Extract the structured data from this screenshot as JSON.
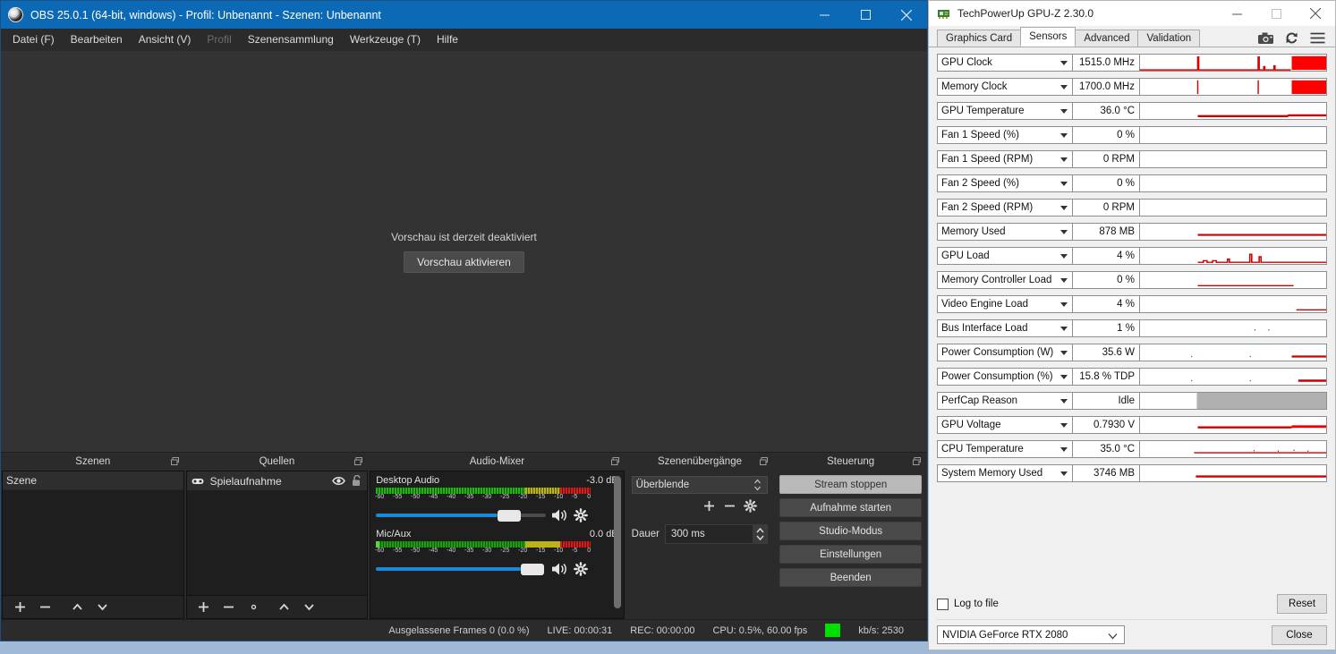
{
  "obs": {
    "title": "OBS 25.0.1 (64-bit, windows) - Profil: Unbenannt - Szenen: Unbenannt",
    "logo_icon": "obs-logo-icon",
    "window_buttons": [
      {
        "name": "minimize-button",
        "label": "—"
      },
      {
        "name": "maximize-button",
        "label": "☐"
      },
      {
        "name": "close-button",
        "label": "✕"
      }
    ],
    "menu": [
      {
        "label": "Datei (F)",
        "disabled": false
      },
      {
        "label": "Bearbeiten",
        "disabled": false
      },
      {
        "label": "Ansicht (V)",
        "disabled": false
      },
      {
        "label": "Profil",
        "disabled": true
      },
      {
        "label": "Szenensammlung",
        "disabled": false
      },
      {
        "label": "Werkzeuge (T)",
        "disabled": false
      },
      {
        "label": "Hilfe",
        "disabled": false
      }
    ],
    "preview": {
      "message": "Vorschau ist derzeit deaktiviert",
      "button": "Vorschau aktivieren"
    },
    "scenes": {
      "title": "Szenen",
      "items": [
        "Szene"
      ],
      "toolbar": [
        "add-icon",
        "remove-icon",
        "move-up-icon",
        "move-down-icon"
      ]
    },
    "sources": {
      "title": "Quellen",
      "items": [
        {
          "label": "Spielaufnahme",
          "type_icon": "game-capture-icon",
          "visible_icon": "eye-icon",
          "lock_icon": "unlocked-icon"
        }
      ],
      "toolbar": [
        "add-icon",
        "remove-icon",
        "properties-gear-icon",
        "move-up-icon",
        "move-down-icon"
      ]
    },
    "mixer": {
      "title": "Audio-Mixer",
      "tracks": [
        {
          "name": "Desktop Audio",
          "level": "-3.0 dB",
          "slider_pct": 71
        },
        {
          "name": "Mic/Aux",
          "level": "0.0 dB",
          "slider_pct": 94
        }
      ],
      "scale_ticks": [
        "-60",
        "-55",
        "-50",
        "-45",
        "-40",
        "-35",
        "-30",
        "-25",
        "-20",
        "-15",
        "-10",
        "-5",
        "0"
      ]
    },
    "transitions": {
      "title": "Szenenübergänge",
      "selected": "Überblende",
      "duration_label": "Dauer",
      "duration_value": "300 ms",
      "buttons": [
        "add-icon",
        "remove-icon",
        "properties-gear-icon"
      ]
    },
    "controls": {
      "title": "Steuerung",
      "buttons": [
        {
          "label": "Stream stoppen",
          "primary": true
        },
        {
          "label": "Aufnahme starten",
          "primary": false
        },
        {
          "label": "Studio-Modus",
          "primary": false
        },
        {
          "label": "Einstellungen",
          "primary": false
        },
        {
          "label": "Beenden",
          "primary": false
        }
      ]
    },
    "status": {
      "dropped_frames": "Ausgelassene Frames 0 (0.0 %)",
      "live": "LIVE: 00:00:31",
      "rec": "REC: 00:00:00",
      "cpu": "CPU: 0.5%, 60.00 fps",
      "live_color": "#00e000",
      "bitrate": "kb/s: 2530"
    }
  },
  "gpuz": {
    "title": "TechPowerUp GPU-Z 2.30.0",
    "icon": "gpu-card-icon",
    "window_buttons": [
      {
        "name": "minimize-button",
        "label": "—"
      },
      {
        "name": "maximize-button",
        "label": "☐"
      },
      {
        "name": "close-button",
        "label": "✕"
      }
    ],
    "tabs": [
      {
        "label": "Graphics Card",
        "active": false
      },
      {
        "label": "Sensors",
        "active": true
      },
      {
        "label": "Advanced",
        "active": false
      },
      {
        "label": "Validation",
        "active": false
      }
    ],
    "tab_icons": [
      "camera-icon",
      "refresh-icon",
      "hamburger-menu-icon"
    ],
    "sensors": [
      {
        "name": "GPU Clock",
        "value": "1515.0 MHz"
      },
      {
        "name": "Memory Clock",
        "value": "1700.0 MHz"
      },
      {
        "name": "GPU Temperature",
        "value": "36.0 °C"
      },
      {
        "name": "Fan 1 Speed (%)",
        "value": "0 %"
      },
      {
        "name": "Fan 1 Speed (RPM)",
        "value": "0 RPM"
      },
      {
        "name": "Fan 2 Speed (%)",
        "value": "0 %"
      },
      {
        "name": "Fan 2 Speed (RPM)",
        "value": "0 RPM"
      },
      {
        "name": "Memory Used",
        "value": "878 MB"
      },
      {
        "name": "GPU Load",
        "value": "4 %"
      },
      {
        "name": "Memory Controller Load",
        "value": "0 %"
      },
      {
        "name": "Video Engine Load",
        "value": "4 %"
      },
      {
        "name": "Bus Interface Load",
        "value": "1 %"
      },
      {
        "name": "Power Consumption (W)",
        "value": "35.6 W"
      },
      {
        "name": "Power Consumption (%)",
        "value": "15.8 % TDP"
      },
      {
        "name": "PerfCap Reason",
        "value": "Idle"
      },
      {
        "name": "GPU Voltage",
        "value": "0.7930 V"
      },
      {
        "name": "CPU Temperature",
        "value": "35.0 °C"
      },
      {
        "name": "System Memory Used",
        "value": "3746 MB"
      }
    ],
    "graph_color": "#e00000",
    "footer": {
      "log_to_file": "Log to file",
      "reset_button": "Reset",
      "gpu_selected": "NVIDIA GeForce RTX 2080",
      "close_button": "Close"
    }
  }
}
